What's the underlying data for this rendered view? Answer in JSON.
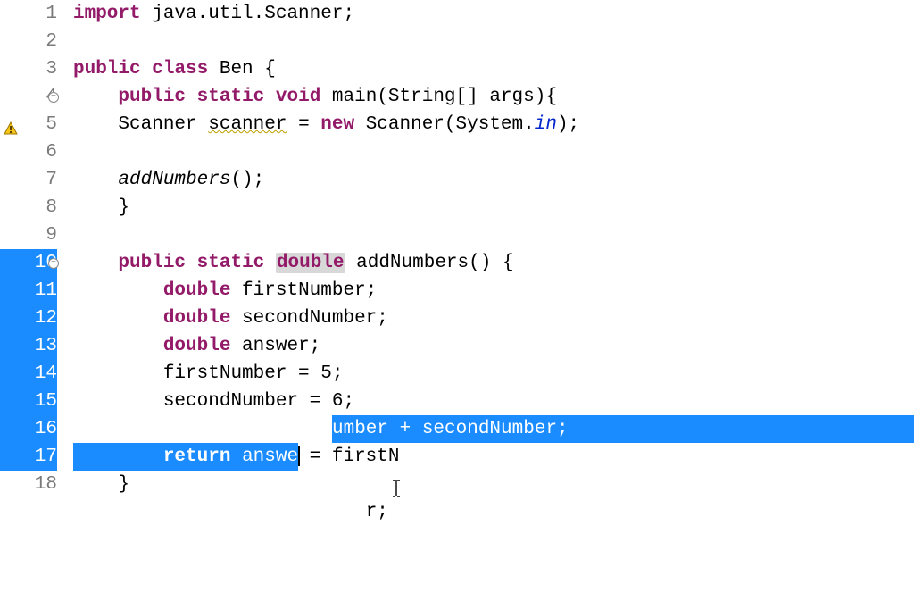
{
  "lines": [
    {
      "num": "1",
      "fold": false,
      "warn": false
    },
    {
      "num": "2",
      "fold": false,
      "warn": false
    },
    {
      "num": "3",
      "fold": false,
      "warn": false
    },
    {
      "num": "4",
      "fold": true,
      "warn": false
    },
    {
      "num": "5",
      "fold": false,
      "warn": true
    },
    {
      "num": "6",
      "fold": false,
      "warn": false
    },
    {
      "num": "7",
      "fold": false,
      "warn": false
    },
    {
      "num": "8",
      "fold": false,
      "warn": false
    },
    {
      "num": "9",
      "fold": false,
      "warn": false
    },
    {
      "num": "10",
      "fold": true,
      "warn": false
    },
    {
      "num": "11",
      "fold": false,
      "warn": false
    },
    {
      "num": "12",
      "fold": false,
      "warn": false
    },
    {
      "num": "13",
      "fold": false,
      "warn": false
    },
    {
      "num": "14",
      "fold": false,
      "warn": false
    },
    {
      "num": "15",
      "fold": false,
      "warn": false
    },
    {
      "num": "16",
      "fold": false,
      "warn": false
    },
    {
      "num": "17",
      "fold": false,
      "warn": false
    },
    {
      "num": "18",
      "fold": false,
      "warn": false
    }
  ],
  "code": {
    "l1": {
      "kw_import": "import",
      "rest": " java.util.Scanner;"
    },
    "l2": {
      "text": ""
    },
    "l3": {
      "kw_public": "public",
      "kw_class": "class",
      "name": " Ben {"
    },
    "l4": {
      "indent": "    ",
      "kw_public": "public",
      "kw_static": "static",
      "kw_void": "void",
      "rest": " main(String[] args){"
    },
    "l5": {
      "indent": "    ",
      "type": "Scanner ",
      "var": "scanner",
      "eq": " = ",
      "kw_new": "new",
      "rest1": " Scanner(System.",
      "in": "in",
      "rest2": ");"
    },
    "l6": {
      "text": ""
    },
    "l7": {
      "indent": "    ",
      "call": "addNumbers",
      "rest": "();"
    },
    "l8": {
      "indent": "    ",
      "brace": "}"
    },
    "l9": {
      "text": ""
    },
    "l10": {
      "indent": "    ",
      "kw_public": "public",
      "kw_static": "static",
      "kw_double": "double",
      "rest": " addNumbers() {"
    },
    "l11": {
      "indent": "        ",
      "kw_double": "double",
      "rest": " firstNumber;"
    },
    "l12": {
      "indent": "        ",
      "kw_double": "double",
      "rest": " secondNumber;"
    },
    "l13": {
      "indent": "        ",
      "kw_double": "double",
      "rest": " answer;"
    },
    "l14": {
      "indent": "        ",
      "text": "firstNumber = 5;"
    },
    "l15": {
      "indent": "        ",
      "text": "secondNumber = 6;"
    },
    "l16": {
      "indent": "        ",
      "before_sel": "answer = firstN",
      "sel": "umber + secondNumber;"
    },
    "l17": {
      "indent": "        ",
      "kw_return": "return",
      "sp": " ",
      "before_cursor": "answe",
      "after_cursor": "r;"
    },
    "l18": {
      "indent": "    ",
      "brace": "}"
    }
  },
  "fold_glyph": "−"
}
